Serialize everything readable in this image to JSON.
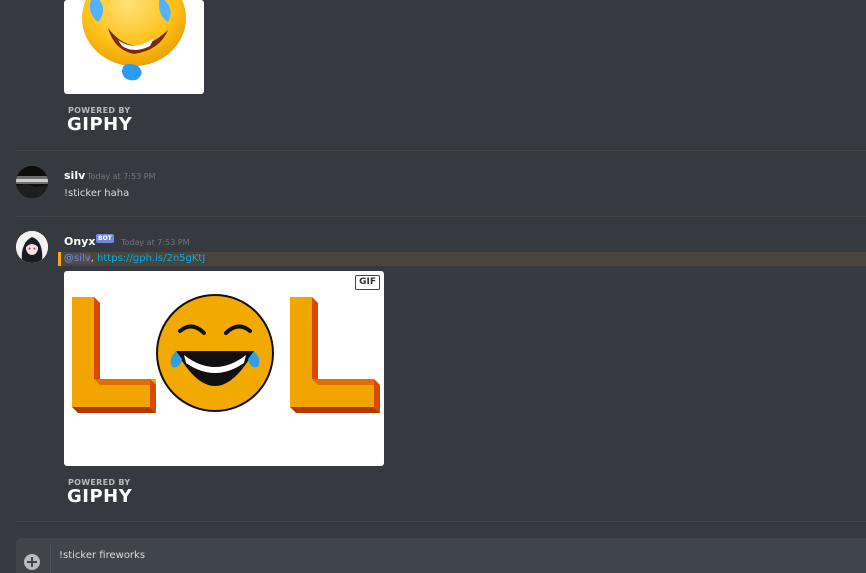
{
  "messages": [
    {
      "embed": {
        "giphy_powered": "POWERED BY",
        "giphy_brand": "GIPHY"
      }
    },
    {
      "author": "silv",
      "timestamp": "Today at 7:53 PM",
      "text": "!sticker haha"
    },
    {
      "author": "Onyx",
      "bot_tag": "BOT",
      "timestamp": "Today at 7:53 PM",
      "mention": "@silv",
      "separator": ", ",
      "link": "https://gph.is/2n5gKtJ",
      "embed": {
        "badge": "GIF",
        "giphy_powered": "POWERED BY",
        "giphy_brand": "GIPHY"
      }
    }
  ],
  "composer": {
    "value": "!sticker fireworks"
  },
  "colors": {
    "background": "#36393f",
    "mention_highlight": "#49443c",
    "mention_bar": "#faa61a",
    "link": "#00b0f4",
    "bot_tag": "#7289da"
  }
}
